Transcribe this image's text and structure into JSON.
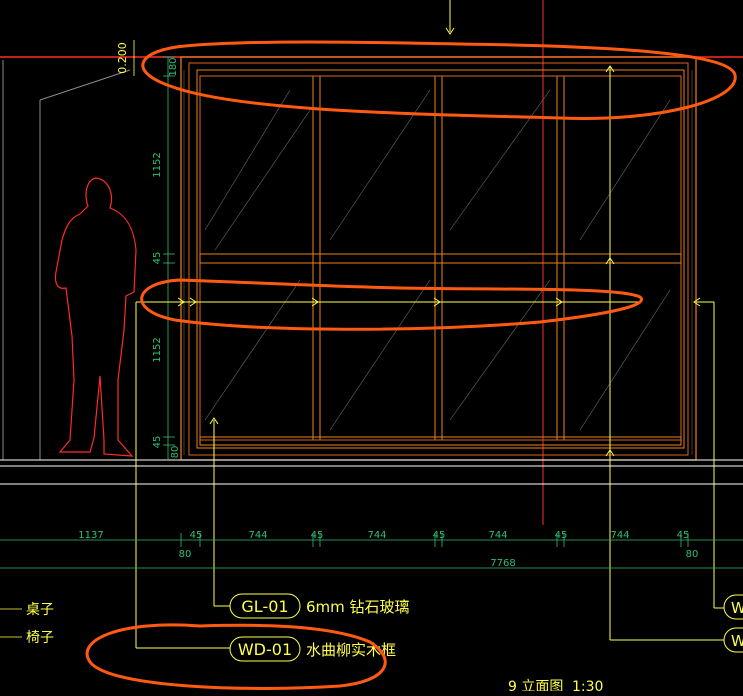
{
  "colors": {
    "background": "#000000",
    "frame": "#e8821e",
    "window": "#d2691e",
    "dim_text": "#2fbf71",
    "yellow": "#ffff4d",
    "human": "#ff2a2a",
    "markup": "#ff5a12",
    "white": "#ffffff",
    "gray": "#8a8a8a"
  },
  "dimensions": {
    "level_top": "0.200",
    "vertical": [
      "180",
      "1152",
      "45",
      "1152",
      "45",
      "80"
    ],
    "horizontal": [
      "1137",
      "45",
      "744",
      "45",
      "744",
      "45",
      "744",
      "45",
      "744",
      "45"
    ],
    "sub": [
      "80",
      "80"
    ],
    "total": "7768"
  },
  "legend": {
    "left_items": [
      "桌子",
      "椅子"
    ]
  },
  "tags": [
    {
      "code": "GL-01",
      "desc": "6mm 钻石玻璃"
    },
    {
      "code": "WD-01",
      "desc": "水曲柳实木框"
    }
  ],
  "right_tags": [
    "W",
    "W"
  ],
  "footer": {
    "title": "9 立面图",
    "scale": "1:30"
  }
}
